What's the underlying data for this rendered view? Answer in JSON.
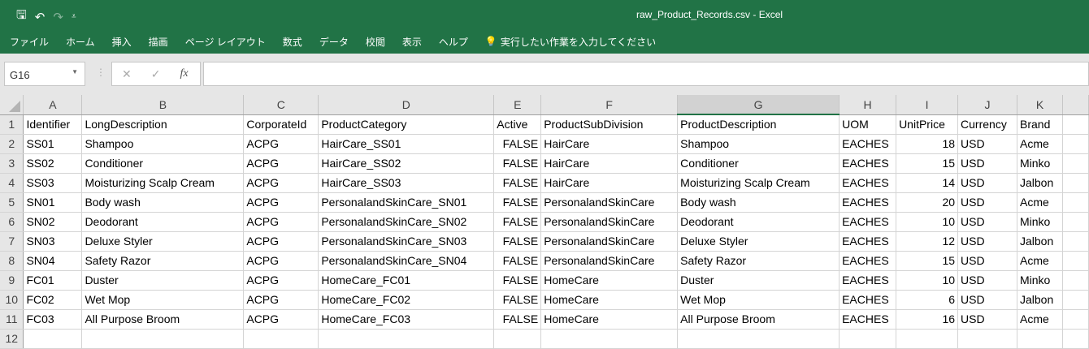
{
  "window": {
    "title": "raw_Product_Records.csv  -  Excel"
  },
  "qat": {
    "save": "🖫",
    "undo": "↶",
    "redo": "↷",
    "customize": "⩡"
  },
  "menu": [
    "ファイル",
    "ホーム",
    "挿入",
    "描画",
    "ページ レイアウト",
    "数式",
    "データ",
    "校閲",
    "表示",
    "ヘルプ"
  ],
  "tell_me": "実行したい作業を入力してください",
  "formula_bar": {
    "name_box": "G16",
    "cancel": "✕",
    "enter": "✓",
    "fx": "fx",
    "value": ""
  },
  "selected_column": "G",
  "columns": [
    "A",
    "B",
    "C",
    "D",
    "E",
    "F",
    "G",
    "H",
    "I",
    "J",
    "K",
    ""
  ],
  "headers": [
    "Identifier",
    "LongDescription",
    "CorporateId",
    "ProductCategory",
    "Active",
    "ProductSubDivision",
    "ProductDescription",
    "UOM",
    "UnitPrice",
    "Currency",
    "Brand",
    ""
  ],
  "rows": [
    [
      "SS01",
      "Shampoo",
      "ACPG",
      "HairCare_SS01",
      "FALSE",
      "HairCare",
      "Shampoo",
      "EACHES",
      "18",
      "USD",
      "Acme",
      ""
    ],
    [
      "SS02",
      "Conditioner",
      "ACPG",
      "HairCare_SS02",
      "FALSE",
      "HairCare",
      "Conditioner",
      "EACHES",
      "15",
      "USD",
      "Minko",
      ""
    ],
    [
      "SS03",
      "Moisturizing Scalp Cream",
      "ACPG",
      "HairCare_SS03",
      "FALSE",
      "HairCare",
      "Moisturizing Scalp Cream",
      "EACHES",
      "14",
      "USD",
      "Jalbon",
      ""
    ],
    [
      "SN01",
      "Body wash",
      "ACPG",
      "PersonalandSkinCare_SN01",
      "FALSE",
      "PersonalandSkinCare",
      "Body wash",
      "EACHES",
      "20",
      "USD",
      "Acme",
      ""
    ],
    [
      "SN02",
      "Deodorant",
      "ACPG",
      "PersonalandSkinCare_SN02",
      "FALSE",
      "PersonalandSkinCare",
      "Deodorant",
      "EACHES",
      "10",
      "USD",
      "Minko",
      ""
    ],
    [
      "SN03",
      "Deluxe Styler",
      "ACPG",
      "PersonalandSkinCare_SN03",
      "FALSE",
      "PersonalandSkinCare",
      "Deluxe Styler",
      "EACHES",
      "12",
      "USD",
      "Jalbon",
      ""
    ],
    [
      "SN04",
      "Safety Razor",
      "ACPG",
      "PersonalandSkinCare_SN04",
      "FALSE",
      "PersonalandSkinCare",
      "Safety Razor",
      "EACHES",
      "15",
      "USD",
      "Acme",
      ""
    ],
    [
      "FC01",
      "Duster",
      "ACPG",
      "HomeCare_FC01",
      "FALSE",
      "HomeCare",
      "Duster",
      "EACHES",
      "10",
      "USD",
      "Minko",
      ""
    ],
    [
      "FC02",
      "Wet Mop",
      "ACPG",
      "HomeCare_FC02",
      "FALSE",
      "HomeCare",
      "Wet Mop",
      "EACHES",
      "6",
      "USD",
      "Jalbon",
      ""
    ],
    [
      "FC03",
      "All Purpose Broom",
      "ACPG",
      "HomeCare_FC03",
      "FALSE",
      "HomeCare",
      "All Purpose Broom",
      "EACHES",
      "16",
      "USD",
      "Acme",
      ""
    ],
    [
      "",
      "",
      "",
      "",
      "",
      "",
      "",
      "",
      "",
      "",
      "",
      ""
    ]
  ]
}
